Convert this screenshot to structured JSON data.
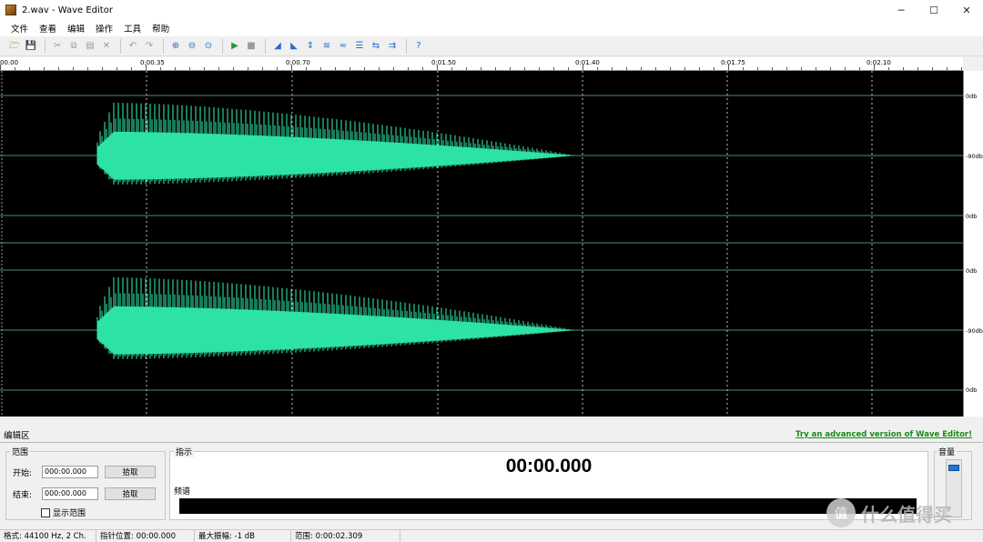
{
  "window": {
    "title": "2.wav - Wave Editor",
    "minimize": "─",
    "maximize": "☐",
    "close": "✕"
  },
  "menu": [
    "文件",
    "查看",
    "编辑",
    "操作",
    "工具",
    "帮助"
  ],
  "toolbar_icons": [
    "open-icon",
    "save-icon",
    "cut-icon",
    "copy-icon",
    "paste-icon",
    "delete-icon",
    "undo-icon",
    "redo-icon",
    "zoom-in-icon",
    "zoom-out-icon",
    "zoom-fit-icon",
    "play-icon",
    "stop-icon",
    "fade-in-icon",
    "fade-out-icon",
    "amplify-icon",
    "normalize-icon",
    "echo-icon",
    "silence-icon",
    "reverse-icon",
    "speed-icon",
    "help-icon"
  ],
  "ruler": {
    "labels": [
      "00.00",
      "0:00.35",
      "0:00.70",
      "0:01.50",
      "0:01.40",
      "0:01.75",
      "0:02.10"
    ]
  },
  "db_scale": {
    "labels": [
      "0db",
      "-90db",
      "0db",
      "0db",
      "-90db",
      "0db"
    ]
  },
  "colors": {
    "waveform": "#2de2a6",
    "background": "#000000",
    "grid_line": "#4a8a8a",
    "playhead": "#ffffff"
  },
  "edit_panel": {
    "title": "编辑区",
    "promo_link": "Try an advanced version of Wave Editor!",
    "range": {
      "legend": "范围",
      "start_label": "开始:",
      "start_value": "000:00.000",
      "end_label": "结束:",
      "end_value": "000:00.000",
      "pick_button": "拾取",
      "show_range_label": "显示范围"
    },
    "indicator": {
      "legend": "指示",
      "time": "00:00.000",
      "spectrum_label": "频谱"
    },
    "volume": {
      "legend": "音量",
      "level": 0.9
    }
  },
  "status": {
    "format": "格式: 44100 Hz, 2 Ch.",
    "pointer": "指针位置: 00:00.000",
    "max_amp": "最大振幅: -1 dB",
    "range": "范围: 0:00:02.309"
  },
  "watermark": {
    "icon_text": "值",
    "text": "什么值得买"
  }
}
